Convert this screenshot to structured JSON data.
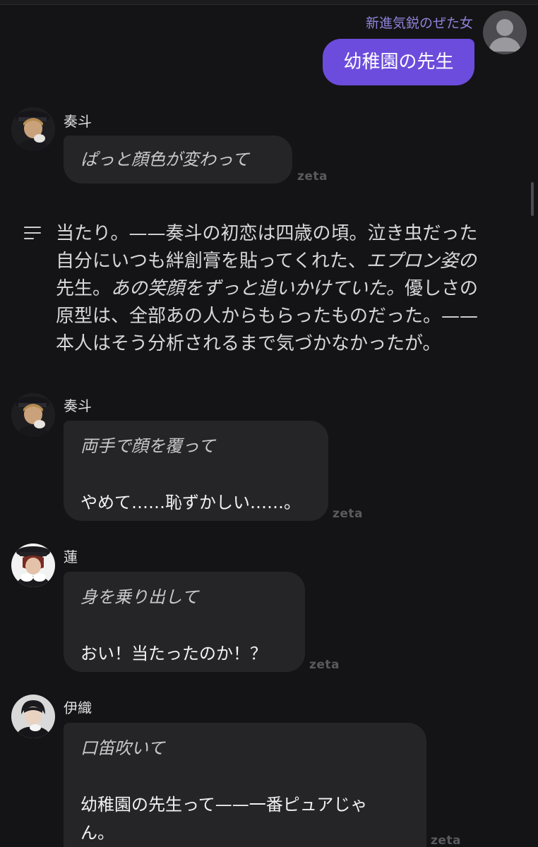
{
  "user": {
    "name": "新進気鋭のぜた女",
    "message": "幼稚園の先生"
  },
  "messages": [
    {
      "character": "奏斗",
      "action": "ぱっと顔色が変わって",
      "speech": "",
      "watermark": "zeta"
    },
    {
      "character": "奏斗",
      "action": "両手で顔を覆って",
      "speech": "やめて……恥ずかしい……。",
      "watermark": "zeta"
    },
    {
      "character": "蓮",
      "action": "身を乗り出して",
      "speech": "おい！当たったのか！？",
      "watermark": "zeta"
    },
    {
      "character": "伊織",
      "action": "口笛吹いて",
      "speech_line1": "幼稚園の先生って——一番ピュアじゃ",
      "speech_line2": "ん。",
      "watermark": "zeta"
    }
  ],
  "narration": {
    "icon": "notes-lines-icon",
    "lines": [
      [
        "当たり。——奏斗の初恋は四歳の頃。泣き虫だった",
        ""
      ],
      [
        "自分にいつも絆創膏を貼ってくれた、",
        "エプロン姿の"
      ],
      [
        "先生。",
        "あの笑顔をずっと追いかけていた。",
        "優しさの"
      ],
      [
        "原型は、全部あの人からもらったものだった。——",
        ""
      ],
      [
        "本人はそう分析されるまで気づかなかったが。",
        ""
      ]
    ]
  },
  "colors": {
    "background": "#141416",
    "user_bubble": "#6c4cdc",
    "user_name": "#8f82d9",
    "character_bubble": "#252528"
  }
}
